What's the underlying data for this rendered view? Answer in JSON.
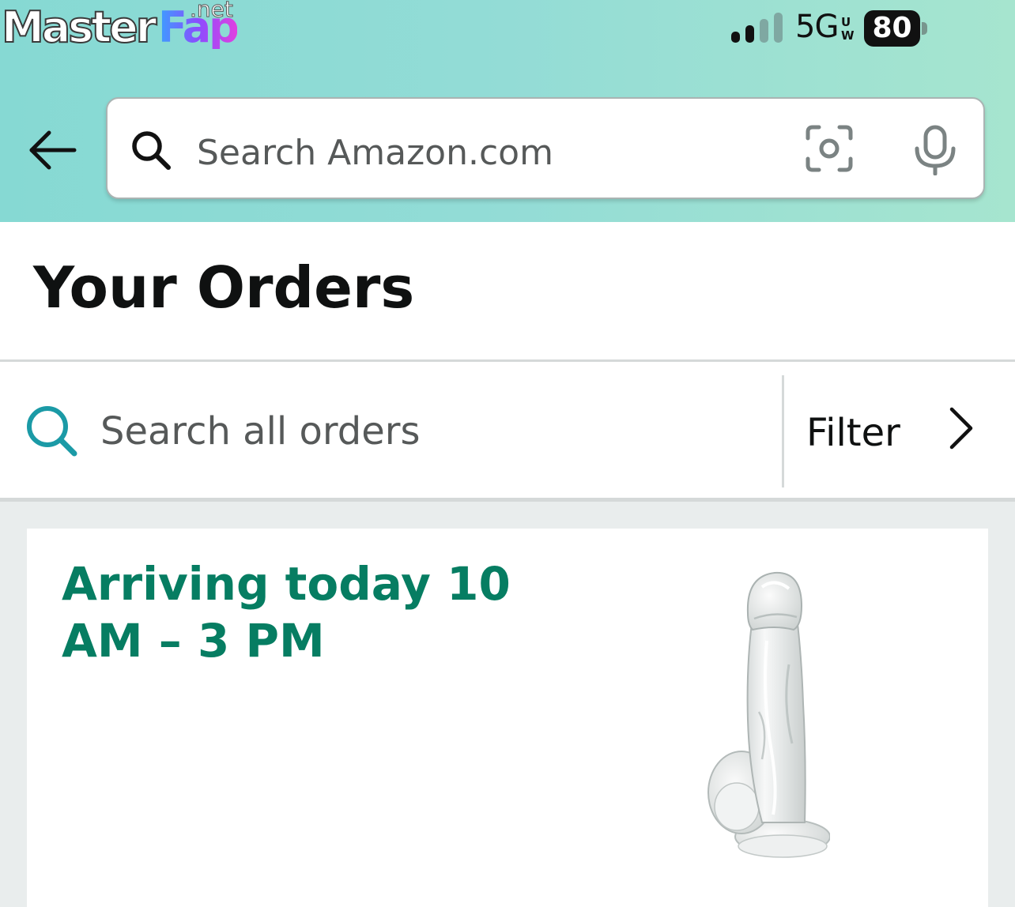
{
  "watermark": {
    "master": "Master",
    "fap": "Fap",
    "net": ".net"
  },
  "status_bar": {
    "network": "5G",
    "network_badge": "UW",
    "battery": "80",
    "signal_bars_active": 2,
    "signal_bars_total": 4
  },
  "header": {
    "search_placeholder": "Search Amazon.com",
    "back_icon": "arrow-left-icon",
    "search_icon": "search-icon",
    "camera_icon": "camera-scan-icon",
    "mic_icon": "microphone-icon"
  },
  "page": {
    "title": "Your Orders"
  },
  "order_search": {
    "placeholder": "Search all orders",
    "filter_label": "Filter",
    "search_icon": "search-icon",
    "chevron_icon": "chevron-right-icon"
  },
  "orders": [
    {
      "status": "Arriving today 10 AM – 3 PM",
      "product_image": "product-thumbnail"
    }
  ],
  "colors": {
    "header_gradient_start": "#86d9d3",
    "header_gradient_end": "#a6e5cf",
    "status_green": "#067d62",
    "search_icon_teal": "#1b9aa6",
    "text_primary": "#0f1111",
    "text_secondary": "#565959",
    "page_bg": "#e9eded"
  }
}
